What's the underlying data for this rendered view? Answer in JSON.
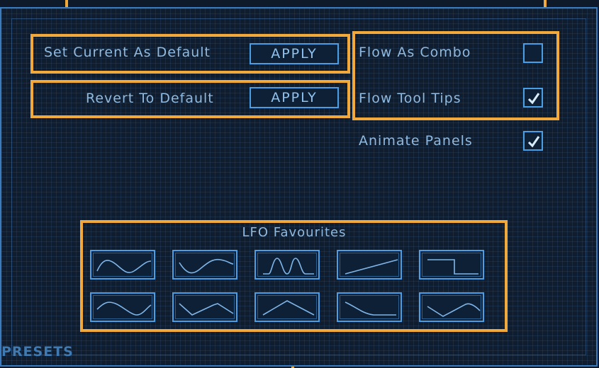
{
  "defaults": {
    "set_current_label": "Set Current As Default",
    "set_current_button": "APPLY",
    "revert_label": "Revert To Default",
    "revert_button": "APPLY"
  },
  "options": {
    "flow_as_combo": {
      "label": "Flow As Combo",
      "checked": false
    },
    "flow_tool_tips": {
      "label": "Flow Tool Tips",
      "checked": true
    },
    "animate_panels": {
      "label": "Animate Panels",
      "checked": true
    }
  },
  "lfo": {
    "title": "LFO Favourites",
    "shapes": [
      "sine-icon",
      "inverted-sine-icon",
      "double-peak-icon",
      "ramp-up-icon",
      "square-icon",
      "triangle-icon",
      "inverted-triangle-icon",
      "triangle-peak-icon",
      "ramp-down-curve-icon",
      "v-shape-icon"
    ]
  },
  "footer": {
    "presets_label": "PRESETS"
  },
  "colors": {
    "accent": "#4a9ee6",
    "callout": "#f2a93b",
    "text": "#8fb9df",
    "background": "#101d2e"
  }
}
